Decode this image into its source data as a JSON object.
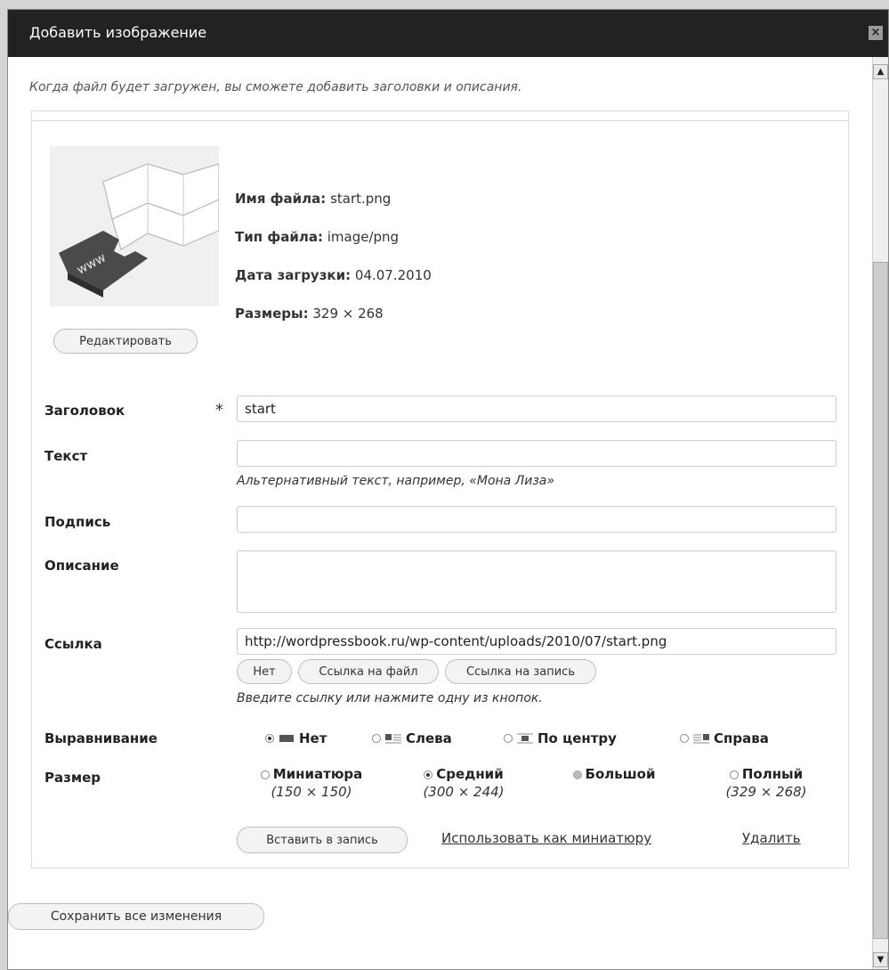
{
  "window": {
    "title": "Добавить изображение",
    "close_icon": "close-icon"
  },
  "hint": "Когда файл будет загружен, вы сможете добавить заголовки и описания.",
  "file": {
    "name_label": "Имя файла:",
    "name_value": "start.png",
    "type_label": "Тип файла:",
    "type_value": "image/png",
    "date_label": "Дата загрузки:",
    "date_value": "04.07.2010",
    "size_label": "Размеры:",
    "size_value": "329 × 268",
    "edit_button": "Редактировать"
  },
  "fields": {
    "title_label": "Заголовок",
    "title_required": "*",
    "title_value": "start",
    "alt_label": "Текст",
    "alt_value": "",
    "alt_help": "Альтернативный текст, например, «Мона Лиза»",
    "caption_label": "Подпись",
    "caption_value": "",
    "description_label": "Описание",
    "description_value": "",
    "link_label": "Ссылка",
    "link_value": "http://wordpressbook.ru/wp-content/uploads/2010/07/start.png",
    "link_buttons": [
      "Нет",
      "Ссылка на файл",
      "Ссылка на запись"
    ],
    "link_help": "Введите ссылку или нажмите одну из кнопок."
  },
  "alignment": {
    "label": "Выравнивание",
    "options": [
      {
        "label": "Нет",
        "checked": true
      },
      {
        "label": "Слева",
        "checked": false
      },
      {
        "label": "По центру",
        "checked": false
      },
      {
        "label": "Справа",
        "checked": false
      }
    ]
  },
  "size": {
    "label": "Размер",
    "options": [
      {
        "name": "Миниатюра",
        "dims": "(150 × 150)",
        "checked": false
      },
      {
        "name": "Средний",
        "dims": "(300 × 244)",
        "checked": true
      },
      {
        "name": "Большой",
        "dims": "",
        "checked": false,
        "disabled": true
      },
      {
        "name": "Полный",
        "dims": "(329 × 268)",
        "checked": false
      }
    ]
  },
  "actions": {
    "insert_button": "Вставить в запись",
    "use_thumbnail_link": "Использовать как миниатюру",
    "delete_link": "Удалить"
  },
  "save_all_button": "Сохранить все изменения"
}
